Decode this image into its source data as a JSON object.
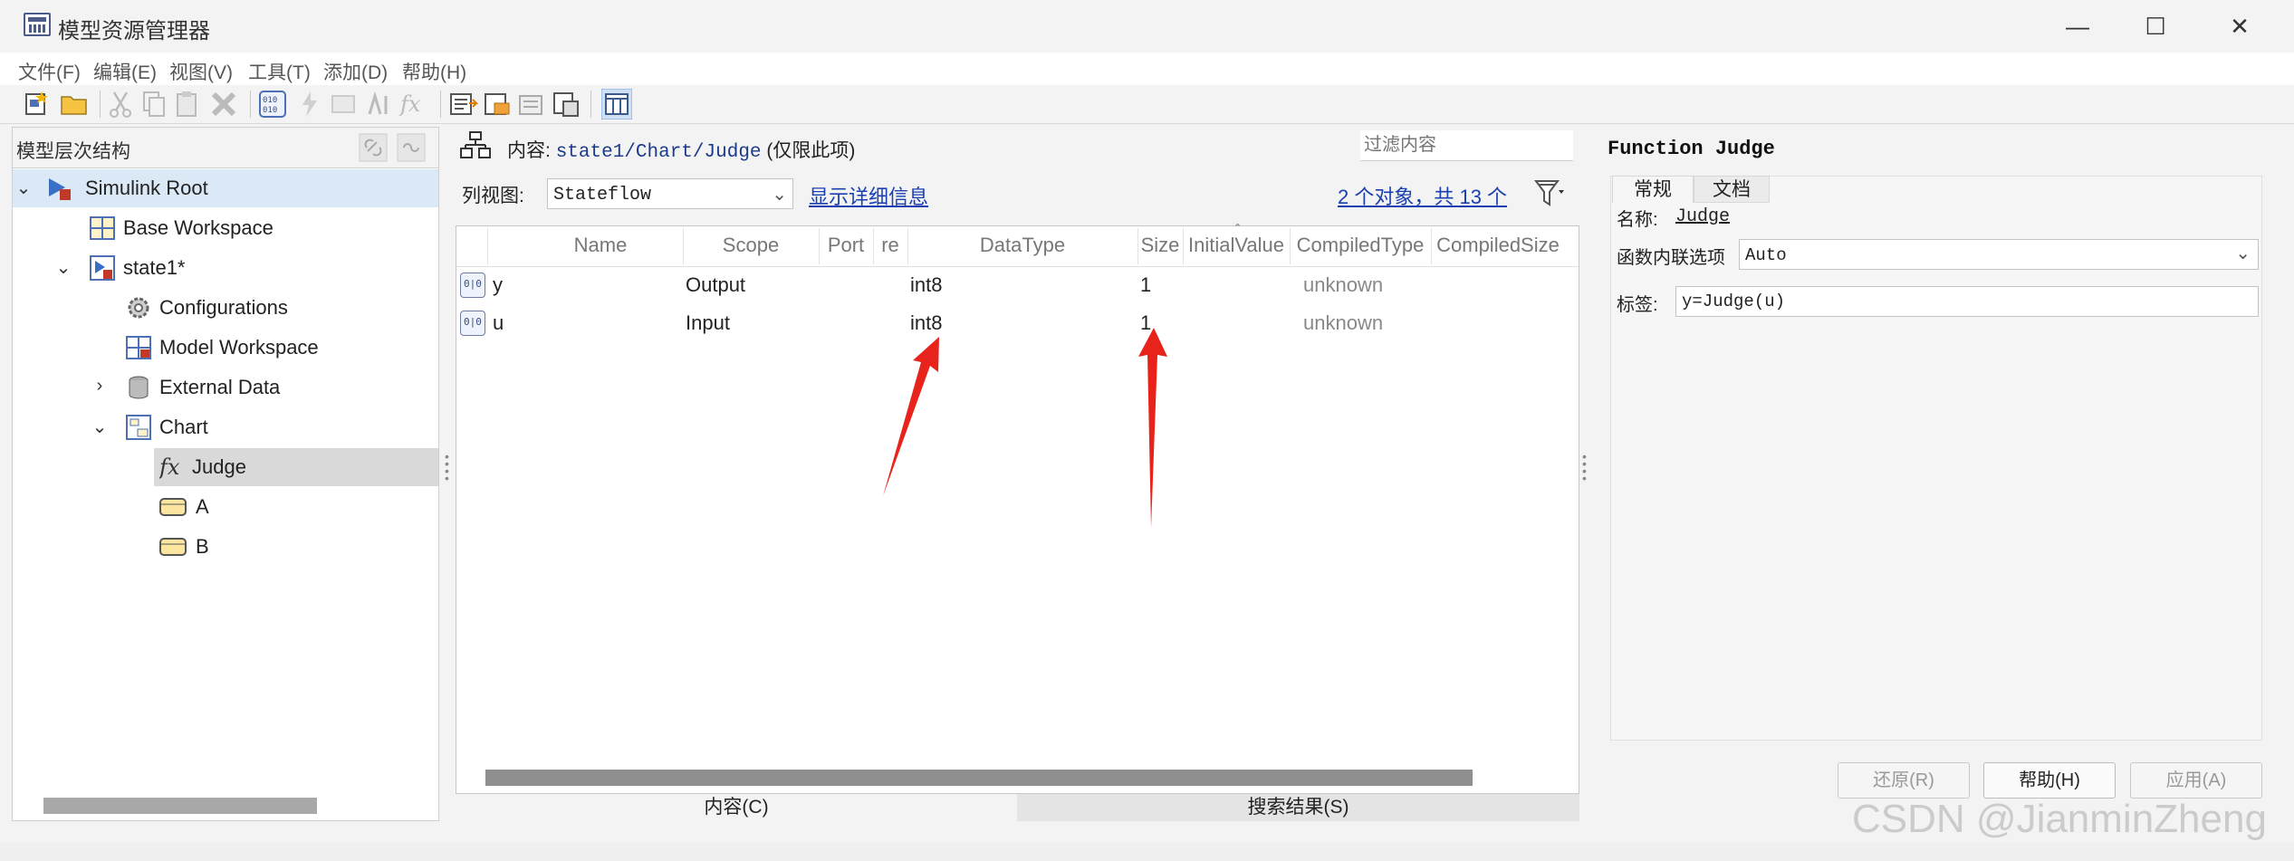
{
  "window": {
    "title": "模型资源管理器",
    "icon": "model-explorer-icon",
    "controls": [
      "minimize",
      "maximize",
      "close"
    ]
  },
  "menu": [
    "文件(F)",
    "编辑(E)",
    "视图(V)",
    "工具(T)",
    "添加(D)",
    "帮助(H)"
  ],
  "toolbar_icons": [
    "new-model-icon",
    "open-icon",
    "cut-icon",
    "copy-icon",
    "paste-icon",
    "delete-icon",
    "add-data-icon",
    "add-event-icon",
    "add-message-icon",
    "add-parameter-icon",
    "add-function-icon",
    "add-signal-icon",
    "add-param-orange-icon",
    "add-port-icon",
    "add-bus-icon",
    "show-columns-icon"
  ],
  "hierarchy": {
    "title": "模型层次结构",
    "nodes": [
      {
        "label": "Simulink Root",
        "icon": "simulink-root-icon",
        "expanded": true,
        "selected": true
      },
      {
        "label": "Base Workspace",
        "icon": "workspace-icon"
      },
      {
        "label": "state1*",
        "icon": "model-icon",
        "expanded": true
      },
      {
        "label": "Configurations",
        "icon": "gear-icon"
      },
      {
        "label": "Model Workspace",
        "icon": "model-workspace-icon"
      },
      {
        "label": "External Data",
        "icon": "database-icon",
        "expanded": false
      },
      {
        "label": "Chart",
        "icon": "chart-icon",
        "expanded": true
      },
      {
        "label": "Judge",
        "icon": "function-icon",
        "highlighted": true
      },
      {
        "label": "A",
        "icon": "state-icon"
      },
      {
        "label": "B",
        "icon": "state-icon"
      }
    ]
  },
  "content": {
    "label_prefix": "内容:",
    "path": "state1/Chart/Judge",
    "scope_note": "(仅限此项)",
    "filter_placeholder": "过滤内容",
    "view_label": "列视图:",
    "view_value": "Stateflow",
    "show_details": "显示详细信息",
    "object_count": "2 个对象，共 13 个"
  },
  "table": {
    "columns": [
      "Name",
      "Scope",
      "Port",
      "re",
      "DataType",
      "Size",
      "InitialValue",
      "CompiledType",
      "CompiledSize"
    ],
    "rows": [
      {
        "name": "y",
        "scope": "Output",
        "datatype": "int8",
        "size": "1",
        "compiled_type": "unknown"
      },
      {
        "name": "u",
        "scope": "Input",
        "datatype": "int8",
        "size": "1",
        "compiled_type": "unknown"
      }
    ]
  },
  "bottom_tabs": [
    "内容(C)",
    "搜索结果(S)"
  ],
  "properties": {
    "title": "Function Judge",
    "tabs": [
      "常规",
      "文档"
    ],
    "name_label": "名称:",
    "name_value": "Judge",
    "inline_label": "函数内联选项",
    "inline_value": "Auto",
    "tag_label": "标签:",
    "tag_value": "y=Judge(u)",
    "buttons": {
      "revert": "还原(R)",
      "help": "帮助(H)",
      "apply": "应用(A)"
    }
  },
  "watermark": "CSDN @JianminZheng",
  "colors": {
    "link": "#1a3fb0",
    "selection": "#dbe8f6",
    "highlight": "#d9d9d9",
    "arrow": "#e8231b"
  }
}
